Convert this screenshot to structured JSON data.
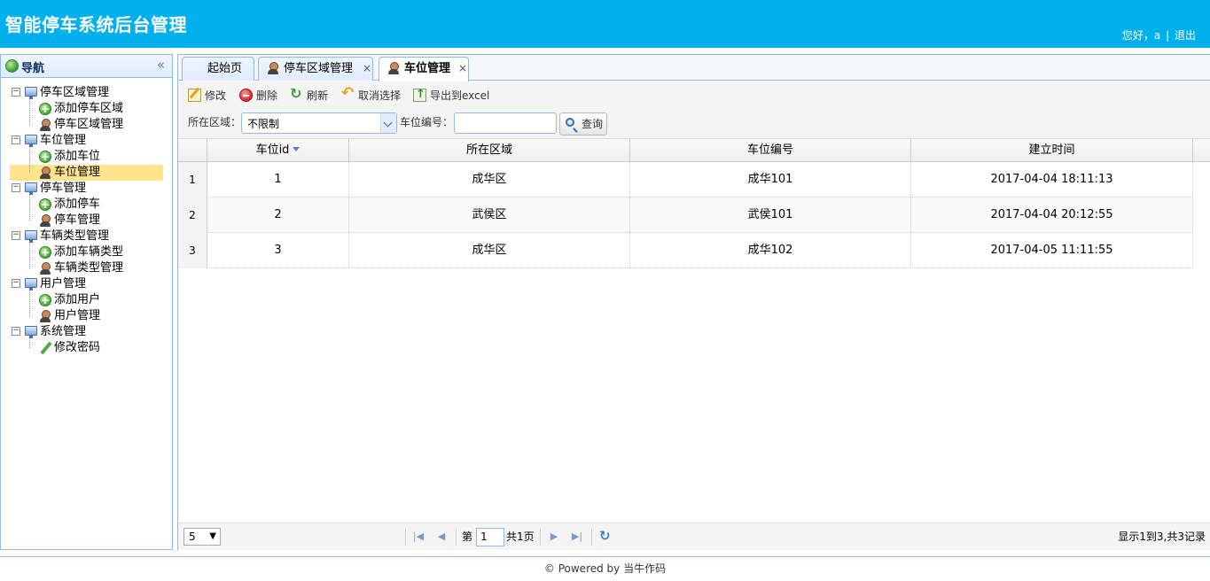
{
  "header": {
    "title": "智能停车系统后台管理",
    "greeting": "您好，a",
    "separator": "|",
    "logout": "退出"
  },
  "nav": {
    "title": "导航",
    "groups": [
      {
        "label": "停车区域管理",
        "children": [
          {
            "label": "添加停车区域",
            "icon": "add-icon"
          },
          {
            "label": "停车区域管理",
            "icon": "user-icon"
          }
        ]
      },
      {
        "label": "车位管理",
        "children": [
          {
            "label": "添加车位",
            "icon": "add-icon"
          },
          {
            "label": "车位管理",
            "icon": "user-icon",
            "selected": true
          }
        ]
      },
      {
        "label": "停车管理",
        "children": [
          {
            "label": "添加停车",
            "icon": "add-icon"
          },
          {
            "label": "停车管理",
            "icon": "user-icon"
          }
        ]
      },
      {
        "label": "车辆类型管理",
        "children": [
          {
            "label": "添加车辆类型",
            "icon": "add-icon"
          },
          {
            "label": "车辆类型管理",
            "icon": "user-icon"
          }
        ]
      },
      {
        "label": "用户管理",
        "children": [
          {
            "label": "添加用户",
            "icon": "add-icon"
          },
          {
            "label": "用户管理",
            "icon": "user-icon"
          }
        ]
      },
      {
        "label": "系统管理",
        "children": [
          {
            "label": "修改密码",
            "icon": "pencil-icon"
          }
        ]
      }
    ]
  },
  "tabs": [
    {
      "label": "起始页",
      "closable": false,
      "active": false
    },
    {
      "label": "停车区域管理",
      "closable": true,
      "active": false
    },
    {
      "label": "车位管理",
      "closable": true,
      "active": true
    }
  ],
  "toolbar": {
    "edit": "修改",
    "delete": "删除",
    "refresh": "刷新",
    "cancel_select": "取消选择",
    "export": "导出到excel"
  },
  "search": {
    "area_label": "所在区域：",
    "area_value": "不限制",
    "number_label": "车位编号：",
    "number_value": "",
    "query": "查询"
  },
  "grid": {
    "columns": [
      "车位id",
      "所在区域",
      "车位编号",
      "建立时间"
    ],
    "sort_column": "车位id",
    "rows": [
      {
        "num": "1",
        "id": "1",
        "area": "成华区",
        "code": "成华101",
        "created": "2017-04-04 18:11:13"
      },
      {
        "num": "2",
        "id": "2",
        "area": "武侯区",
        "code": "武侯101",
        "created": "2017-04-04 20:12:55"
      },
      {
        "num": "3",
        "id": "3",
        "area": "成华区",
        "code": "成华102",
        "created": "2017-04-05 11:11:55"
      }
    ]
  },
  "pager": {
    "page_size": "5",
    "page_prefix": "第",
    "page_value": "1",
    "page_suffix": "共1页",
    "info": "显示1到3,共3记录"
  },
  "footer": "© Powered by 当牛作码"
}
